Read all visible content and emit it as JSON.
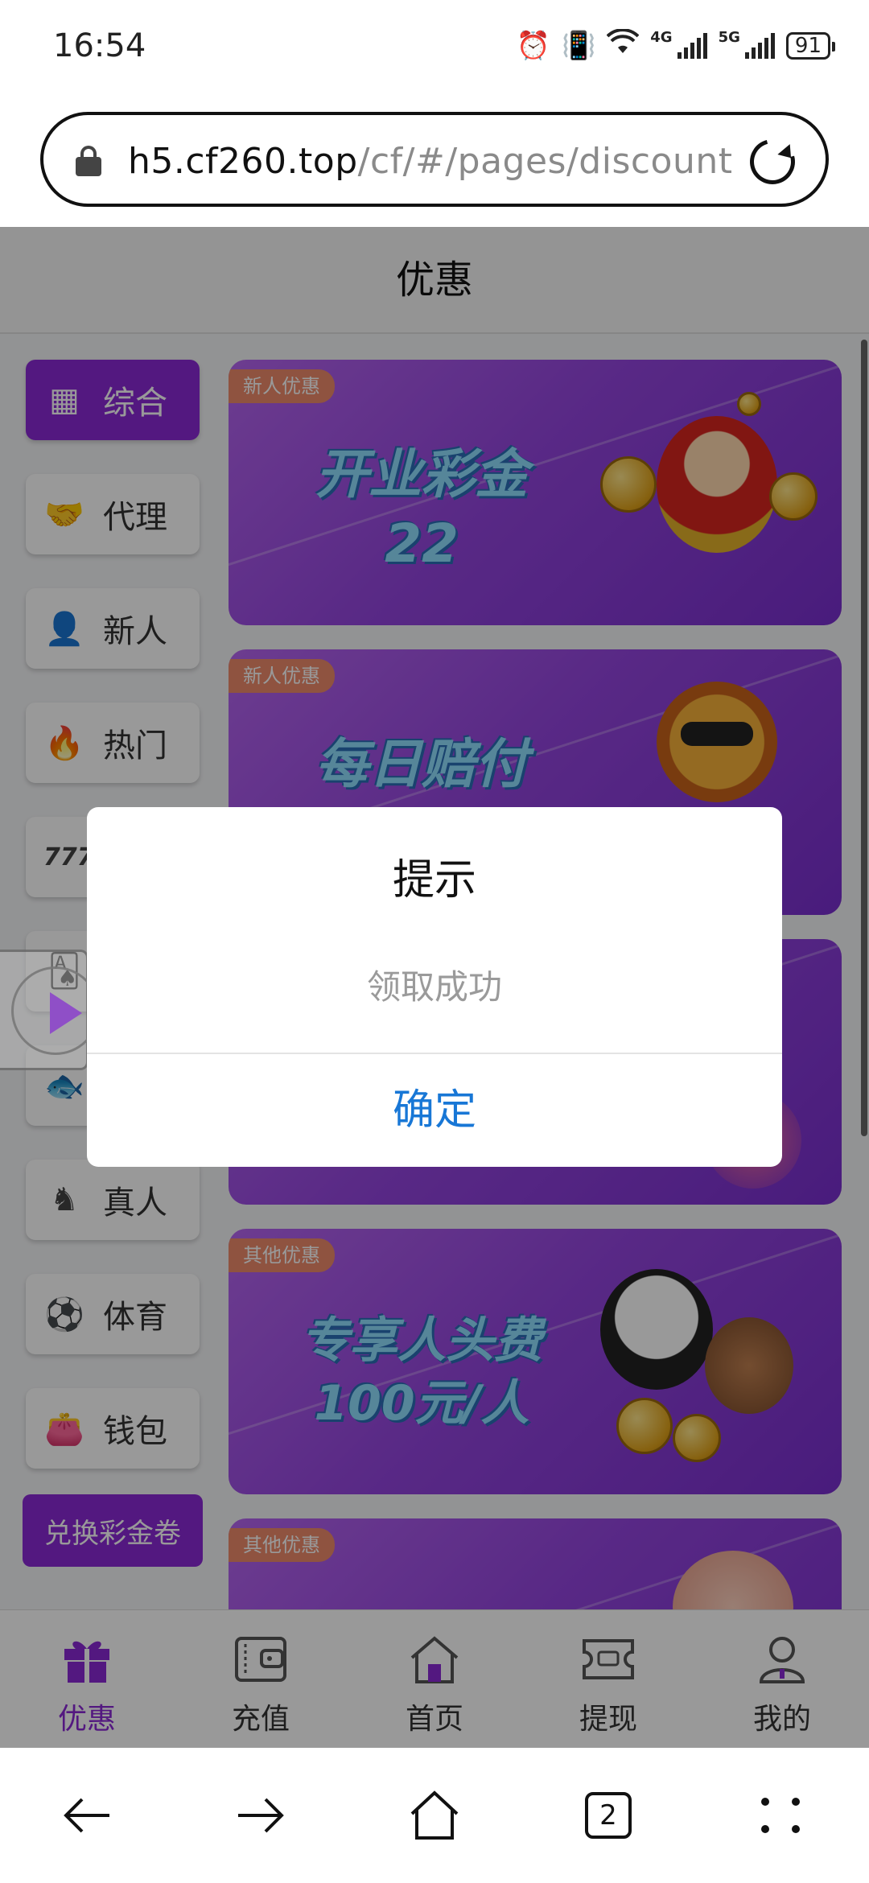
{
  "status": {
    "time": "16:54",
    "net1": "4G",
    "net2": "5G",
    "battery": "91"
  },
  "browser": {
    "url_domain": "h5.cf260.top",
    "url_path": "/cf/#/pages/discount"
  },
  "header": {
    "title": "优惠"
  },
  "sidebar": {
    "items": [
      {
        "label": "综合",
        "icon": "grid-icon",
        "active": true
      },
      {
        "label": "代理",
        "icon": "handshake-icon"
      },
      {
        "label": "新人",
        "icon": "person-icon"
      },
      {
        "label": "热门",
        "icon": "fire-icon"
      },
      {
        "label": "",
        "icon": "slots-777-icon"
      },
      {
        "label": "",
        "icon": "cards-icon"
      },
      {
        "label": "",
        "icon": "fish-icon"
      },
      {
        "label": "真人",
        "icon": "dealer-icon"
      },
      {
        "label": "体育",
        "icon": "soccer-icon"
      },
      {
        "label": "钱包",
        "icon": "wallet-icon"
      }
    ],
    "exchange_label": "兑换彩金卷"
  },
  "banners": [
    {
      "tag": "新人优惠",
      "title_line1": "开业彩金",
      "title_line2": "22"
    },
    {
      "tag": "新人优惠",
      "title_line1": "每日赔付",
      "title_line2": ""
    },
    {
      "tag": "",
      "title_line1": "",
      "title_line2": ""
    },
    {
      "tag": "其他优惠",
      "title_line1": "专享人头费",
      "title_line2": "100元/人"
    },
    {
      "tag": "其他优惠",
      "title_line1": "",
      "title_line2": ""
    }
  ],
  "bottom_nav": [
    {
      "label": "优惠",
      "icon": "gift-icon",
      "active": true
    },
    {
      "label": "充值",
      "icon": "wallet-card-icon"
    },
    {
      "label": "首页",
      "icon": "home-icon"
    },
    {
      "label": "提现",
      "icon": "withdraw-ticket-icon"
    },
    {
      "label": "我的",
      "icon": "user-icon"
    }
  ],
  "dialog": {
    "title": "提示",
    "message": "领取成功",
    "ok_label": "确定"
  },
  "system_nav": {
    "tab_count": "2"
  },
  "colors": {
    "accent": "#8b28d6",
    "dialog_button": "#1877d6",
    "banner_tag": "#ef8a6b"
  }
}
